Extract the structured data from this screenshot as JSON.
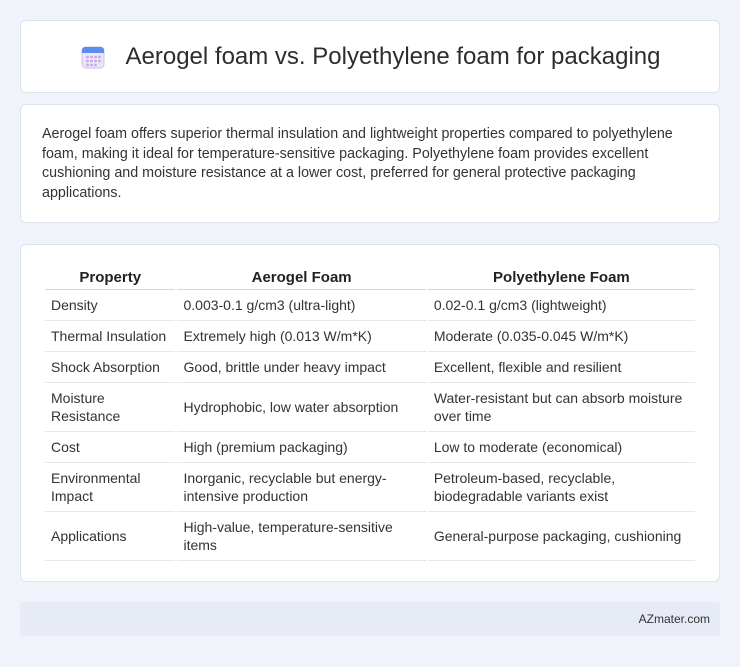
{
  "header": {
    "title": "Aerogel foam vs. Polyethylene foam for packaging",
    "icon": "calendar-icon",
    "icon_colors": {
      "top": "#5b8def",
      "body": "#e9e3f7",
      "dots": "#c7a8e8"
    }
  },
  "summary": {
    "text": "Aerogel foam offers superior thermal insulation and lightweight properties compared to polyethylene foam, making it ideal for temperature-sensitive packaging. Polyethylene foam provides excellent cushioning and moisture resistance at a lower cost, preferred for general protective packaging applications."
  },
  "table": {
    "headers": [
      "Property",
      "Aerogel Foam",
      "Polyethylene Foam"
    ],
    "rows": [
      [
        "Density",
        "0.003-0.1 g/cm3 (ultra-light)",
        "0.02-0.1 g/cm3 (lightweight)"
      ],
      [
        "Thermal Insulation",
        "Extremely high (0.013 W/m*K)",
        "Moderate (0.035-0.045 W/m*K)"
      ],
      [
        "Shock Absorption",
        "Good, brittle under heavy impact",
        "Excellent, flexible and resilient"
      ],
      [
        "Moisture Resistance",
        "Hydrophobic, low water absorption",
        "Water-resistant but can absorb moisture over time"
      ],
      [
        "Cost",
        "High (premium packaging)",
        "Low to moderate (economical)"
      ],
      [
        "Environmental Impact",
        "Inorganic, recyclable but energy-intensive production",
        "Petroleum-based, recyclable, biodegradable variants exist"
      ],
      [
        "Applications",
        "High-value, temperature-sensitive items",
        "General-purpose packaging, cushioning"
      ]
    ]
  },
  "footer": {
    "text": "AZmater.com"
  }
}
